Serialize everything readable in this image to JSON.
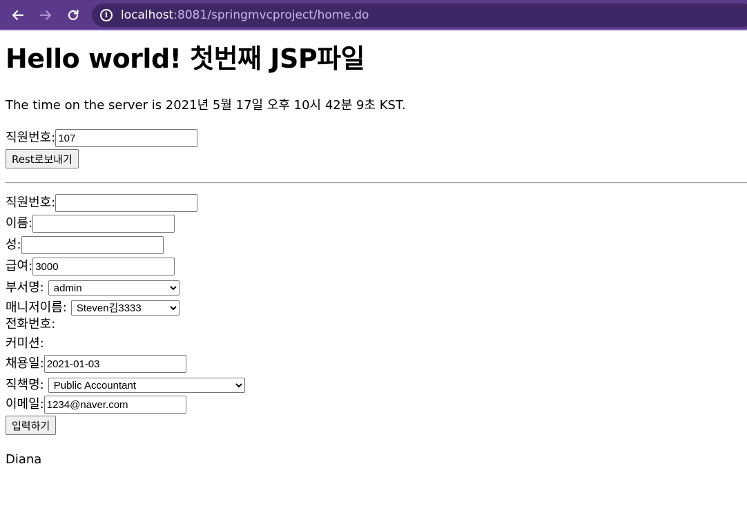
{
  "browser": {
    "url_host": "localhost",
    "url_rest": ":8081/springmvcproject/home.do"
  },
  "page": {
    "heading": "Hello world! 첫번째 JSP파일",
    "server_time": "The time on the server is 2021년 5월 17일 오후 10시 42분 9초 KST."
  },
  "rest_form": {
    "emp_id_label": "직원번호:",
    "emp_id_value": "107",
    "submit_label": "Rest로보내기"
  },
  "employee_form": {
    "emp_id_label": "직원번호:",
    "emp_id_value": "",
    "first_name_label": "이름:",
    "first_name_value": "",
    "last_name_label": "성:",
    "last_name_value": "",
    "salary_label": "급여:",
    "salary_value": "3000",
    "department_label": "부서명:",
    "department_selected": "admin",
    "manager_label": "매니저이름:",
    "manager_selected": "Steven김3333",
    "phone_label": "전화번호:",
    "commission_label": "커미션:",
    "hire_date_label": "채용일:",
    "hire_date_value": "2021-01-03",
    "job_label": "직책명:",
    "job_selected": "Public Accountant",
    "email_label": "이메일:",
    "email_value": "1234@naver.com",
    "submit_label": "입력하기"
  },
  "result_text": "Diana",
  "colors": {
    "browser_bar": "#5b3a8c",
    "omnibox": "#3f2766"
  }
}
